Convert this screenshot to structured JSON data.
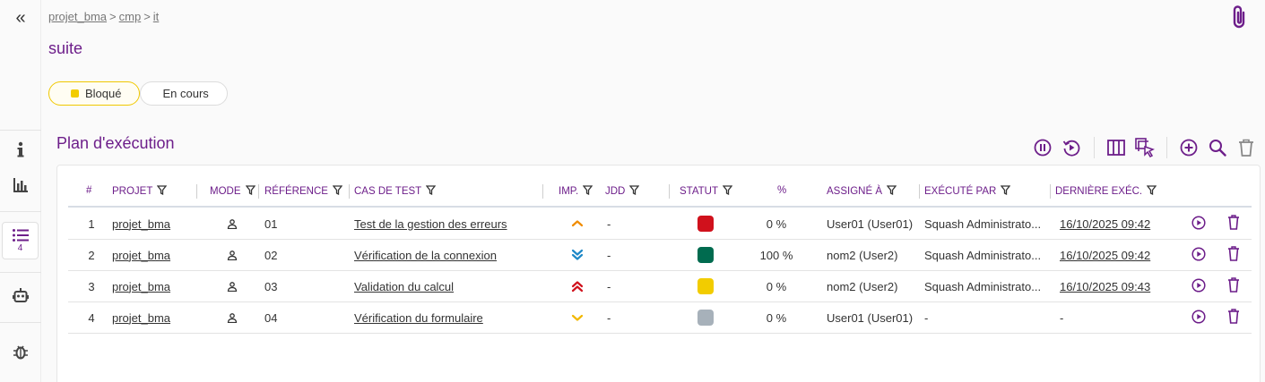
{
  "breadcrumb": {
    "items": [
      "projet_bma",
      "cmp",
      "it"
    ],
    "separator": ">"
  },
  "page_title": "suite",
  "status_chips": [
    {
      "label": "Bloqué",
      "active": true,
      "color": "#f2cc00"
    },
    {
      "label": "En cours",
      "active": false
    }
  ],
  "rail": {
    "test_plan_count": "4"
  },
  "section": {
    "title": "Plan d'exécution"
  },
  "toolbar": {
    "icons": [
      "pause-icon",
      "replay-icon",
      "columns-icon",
      "multi-select-icon",
      "add-icon",
      "search-icon",
      "delete-icon"
    ]
  },
  "table": {
    "headers": {
      "index": "#",
      "project": "PROJET",
      "mode": "MODE",
      "reference": "RÉFÉRENCE",
      "test_case": "CAS DE TEST",
      "importance": "IMP.",
      "dataset": "JDD",
      "status": "STATUT",
      "percent": "%",
      "assigned": "ASSIGNÉ À",
      "executed_by": "EXÉCUTÉ PAR",
      "last_exec": "DERNIÈRE EXÉC."
    },
    "rows": [
      {
        "index": "1",
        "project": "projet_bma",
        "mode": "manual",
        "reference": "01",
        "test_case": "Test de la gestion des erreurs",
        "importance": "medium",
        "importance_color": "#f08c00",
        "dataset": "-",
        "status_color": "#d0111c",
        "percent": "0 %",
        "assigned": "User01 (User01)",
        "executed_by": "Squash Administrato...",
        "last_exec": "16/10/2025 09:42"
      },
      {
        "index": "2",
        "project": "projet_bma",
        "mode": "manual",
        "reference": "02",
        "test_case": "Vérification de la connexion",
        "importance": "very-low",
        "importance_color": "#1e88c7",
        "dataset": "-",
        "status_color": "#006b4f",
        "percent": "100 %",
        "assigned": "nom2 (User2)",
        "executed_by": "Squash Administrato...",
        "last_exec": "16/10/2025 09:42"
      },
      {
        "index": "3",
        "project": "projet_bma",
        "mode": "manual",
        "reference": "03",
        "test_case": "Validation du calcul",
        "importance": "very-high",
        "importance_color": "#d0111c",
        "dataset": "-",
        "status_color": "#f2cc00",
        "percent": "0 %",
        "assigned": "nom2 (User2)",
        "executed_by": "Squash Administrato...",
        "last_exec": "16/10/2025 09:43"
      },
      {
        "index": "4",
        "project": "projet_bma",
        "mode": "manual",
        "reference": "04",
        "test_case": "Vérification du formulaire",
        "importance": "low",
        "importance_color": "#f2b800",
        "dataset": "-",
        "status_color": "#a7b1ba",
        "percent": "0 %",
        "assigned": "User01 (User01)",
        "executed_by": "-",
        "last_exec": "-"
      }
    ]
  },
  "colors": {
    "accent": "#6d1e8a"
  }
}
